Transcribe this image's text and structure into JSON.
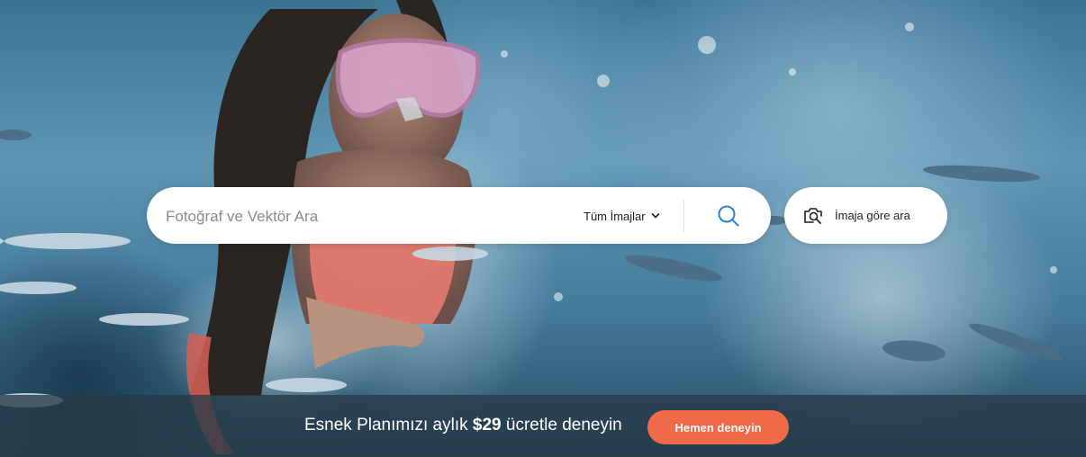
{
  "search": {
    "placeholder": "Fotoğraf ve Vektör Ara",
    "filter_label": "Tüm İmajlar",
    "search_icon": "search-icon",
    "chevron_icon": "chevron-down-icon"
  },
  "image_search": {
    "label": "İmaja göre ara",
    "icon": "camera-search-icon"
  },
  "promo": {
    "text_before": "Esnek Planımızı aylık ",
    "price": "$29",
    "text_after": " ücretle deneyin",
    "button_label": "Hemen deneyin"
  },
  "colors": {
    "accent": "#ef6a48",
    "search_icon": "#2f7fd0",
    "promo_bg": "#283a46"
  }
}
